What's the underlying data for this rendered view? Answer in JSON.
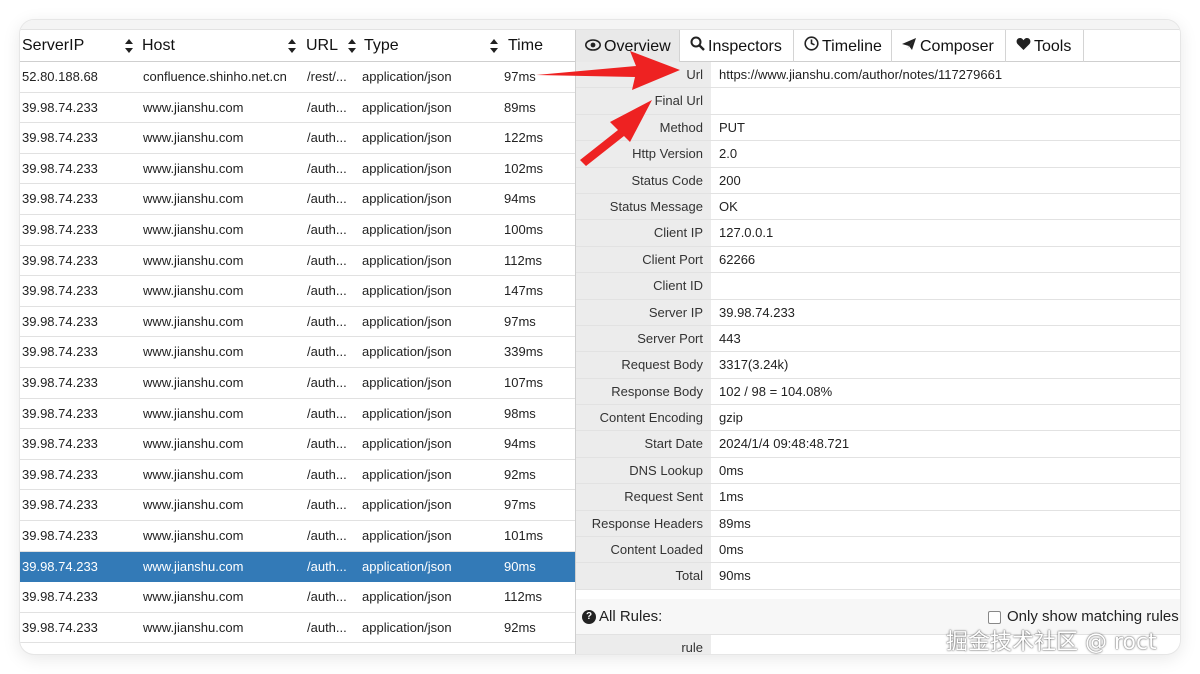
{
  "list": {
    "columns": [
      {
        "label": "ServerIP"
      },
      {
        "label": "Host"
      },
      {
        "label": "URL"
      },
      {
        "label": "Type"
      },
      {
        "label": "Time"
      }
    ],
    "rows": [
      {
        "ip": "52.80.188.68",
        "host": "confluence.shinho.net.cn",
        "url": "/rest/...",
        "type": "application/json",
        "time": "97ms"
      },
      {
        "ip": "39.98.74.233",
        "host": "www.jianshu.com",
        "url": "/auth...",
        "type": "application/json",
        "time": "89ms"
      },
      {
        "ip": "39.98.74.233",
        "host": "www.jianshu.com",
        "url": "/auth...",
        "type": "application/json",
        "time": "122ms"
      },
      {
        "ip": "39.98.74.233",
        "host": "www.jianshu.com",
        "url": "/auth...",
        "type": "application/json",
        "time": "102ms"
      },
      {
        "ip": "39.98.74.233",
        "host": "www.jianshu.com",
        "url": "/auth...",
        "type": "application/json",
        "time": "94ms"
      },
      {
        "ip": "39.98.74.233",
        "host": "www.jianshu.com",
        "url": "/auth...",
        "type": "application/json",
        "time": "100ms"
      },
      {
        "ip": "39.98.74.233",
        "host": "www.jianshu.com",
        "url": "/auth...",
        "type": "application/json",
        "time": "112ms"
      },
      {
        "ip": "39.98.74.233",
        "host": "www.jianshu.com",
        "url": "/auth...",
        "type": "application/json",
        "time": "147ms"
      },
      {
        "ip": "39.98.74.233",
        "host": "www.jianshu.com",
        "url": "/auth...",
        "type": "application/json",
        "time": "97ms"
      },
      {
        "ip": "39.98.74.233",
        "host": "www.jianshu.com",
        "url": "/auth...",
        "type": "application/json",
        "time": "339ms"
      },
      {
        "ip": "39.98.74.233",
        "host": "www.jianshu.com",
        "url": "/auth...",
        "type": "application/json",
        "time": "107ms"
      },
      {
        "ip": "39.98.74.233",
        "host": "www.jianshu.com",
        "url": "/auth...",
        "type": "application/json",
        "time": "98ms"
      },
      {
        "ip": "39.98.74.233",
        "host": "www.jianshu.com",
        "url": "/auth...",
        "type": "application/json",
        "time": "94ms"
      },
      {
        "ip": "39.98.74.233",
        "host": "www.jianshu.com",
        "url": "/auth...",
        "type": "application/json",
        "time": "92ms"
      },
      {
        "ip": "39.98.74.233",
        "host": "www.jianshu.com",
        "url": "/auth...",
        "type": "application/json",
        "time": "97ms"
      },
      {
        "ip": "39.98.74.233",
        "host": "www.jianshu.com",
        "url": "/auth...",
        "type": "application/json",
        "time": "101ms"
      },
      {
        "ip": "39.98.74.233",
        "host": "www.jianshu.com",
        "url": "/auth...",
        "type": "application/json",
        "time": "90ms"
      },
      {
        "ip": "39.98.74.233",
        "host": "www.jianshu.com",
        "url": "/auth...",
        "type": "application/json",
        "time": "112ms"
      },
      {
        "ip": "39.98.74.233",
        "host": "www.jianshu.com",
        "url": "/auth...",
        "type": "application/json",
        "time": "92ms"
      }
    ],
    "selected_index": 16,
    "selected_color": "#337ab7"
  },
  "tabs": [
    {
      "label": "Overview",
      "icon": "eye-icon",
      "active": true
    },
    {
      "label": "Inspectors",
      "icon": "magnifier-icon",
      "active": false
    },
    {
      "label": "Timeline",
      "icon": "clock-icon",
      "active": false
    },
    {
      "label": "Composer",
      "icon": "paper-plane-icon",
      "active": false
    },
    {
      "label": "Tools",
      "icon": "heart-icon",
      "active": false
    }
  ],
  "overview": [
    {
      "key": "Url",
      "value": "https://www.jianshu.com/author/notes/117279661"
    },
    {
      "key": "Final Url",
      "value": ""
    },
    {
      "key": "Method",
      "value": "PUT"
    },
    {
      "key": "Http Version",
      "value": "2.0"
    },
    {
      "key": "Status Code",
      "value": "200"
    },
    {
      "key": "Status Message",
      "value": "OK"
    },
    {
      "key": "Client IP",
      "value": "127.0.0.1"
    },
    {
      "key": "Client Port",
      "value": "62266"
    },
    {
      "key": "Client ID",
      "value": ""
    },
    {
      "key": "Server IP",
      "value": "39.98.74.233"
    },
    {
      "key": "Server Port",
      "value": "443"
    },
    {
      "key": "Request Body",
      "value": "3317(3.24k)"
    },
    {
      "key": "Response Body",
      "value": "102 / 98 = 104.08%"
    },
    {
      "key": "Content Encoding",
      "value": "gzip"
    },
    {
      "key": "Start Date",
      "value": "2024/1/4 09:48:48.721"
    },
    {
      "key": "DNS Lookup",
      "value": "0ms"
    },
    {
      "key": "Request Sent",
      "value": "1ms"
    },
    {
      "key": "Response Headers",
      "value": "89ms"
    },
    {
      "key": "Content Loaded",
      "value": "0ms"
    },
    {
      "key": "Total",
      "value": "90ms"
    }
  ],
  "rules": {
    "title": "All Rules:",
    "only_matching_label": "Only show matching rules",
    "only_matching_checked": false,
    "rule_key": "rule"
  },
  "annotation": {
    "arrow_color": "#ee2222"
  },
  "watermark": "掘金技术社区 @ roct"
}
